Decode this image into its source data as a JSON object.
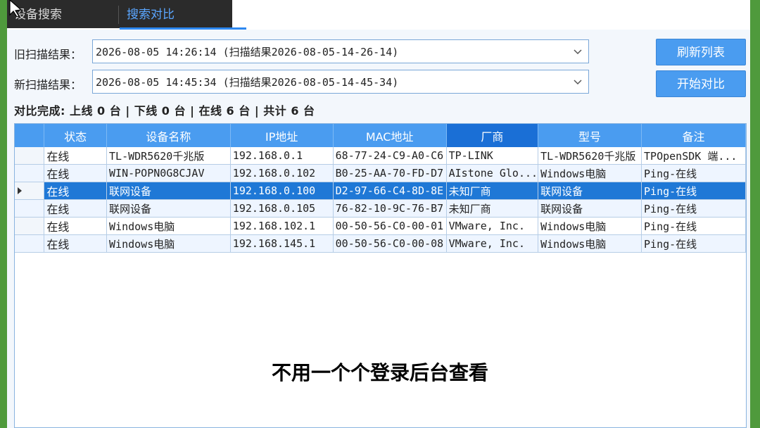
{
  "tabs": [
    {
      "label": "设备搜索",
      "active": false
    },
    {
      "label": "搜索对比",
      "active": true
    }
  ],
  "old_scan": {
    "label": "旧扫描结果：",
    "value": "2026-08-05 14:26:14 (扫描结果2026-08-05-14-26-14)"
  },
  "new_scan": {
    "label": "新扫描结果：",
    "value": "2026-08-05 14:45:34 (扫描结果2026-08-05-14-45-34)"
  },
  "buttons": {
    "refresh": "刷新列表",
    "compare": "开始对比"
  },
  "summary": "对比完成: 上线 0 台 | 下线 0 台 | 在线 6 台 | 共计 6 台",
  "table": {
    "columns": [
      "状态",
      "设备名称",
      "IP地址",
      "MAC地址",
      "厂商",
      "型号",
      "备注"
    ],
    "sorted_column": "厂商",
    "selected_row": 2,
    "rows": [
      [
        "在线",
        "TL-WDR5620千兆版",
        "192.168.0.1",
        "68-77-24-C9-A0-C6",
        "TP-LINK",
        "TL-WDR5620千兆版",
        "TPOpenSDK 端..."
      ],
      [
        "在线",
        "WIN-POPN0G8CJAV",
        "192.168.0.102",
        "B0-25-AA-70-FD-D7",
        "AIstone Glo...",
        "Windows电脑",
        "Ping-在线"
      ],
      [
        "在线",
        "联网设备",
        "192.168.0.100",
        "D2-97-66-C4-8D-8E",
        "未知厂商",
        "联网设备",
        "Ping-在线"
      ],
      [
        "在线",
        "联网设备",
        "192.168.0.105",
        "76-82-10-9C-76-B7",
        "未知厂商",
        "联网设备",
        "Ping-在线"
      ],
      [
        "在线",
        "Windows电脑",
        "192.168.102.1",
        "00-50-56-C0-00-01",
        "VMware, Inc.",
        "Windows电脑",
        "Ping-在线"
      ],
      [
        "在线",
        "Windows电脑",
        "192.168.145.1",
        "00-50-56-C0-00-08",
        "VMware, Inc.",
        "Windows电脑",
        "Ping-在线"
      ]
    ]
  },
  "caption": "不用一个个登录后台查看",
  "colors": {
    "accent": "#4a9cf0",
    "selected_row": "#1f78d6",
    "tab_active_text": "#5aa6ff"
  }
}
